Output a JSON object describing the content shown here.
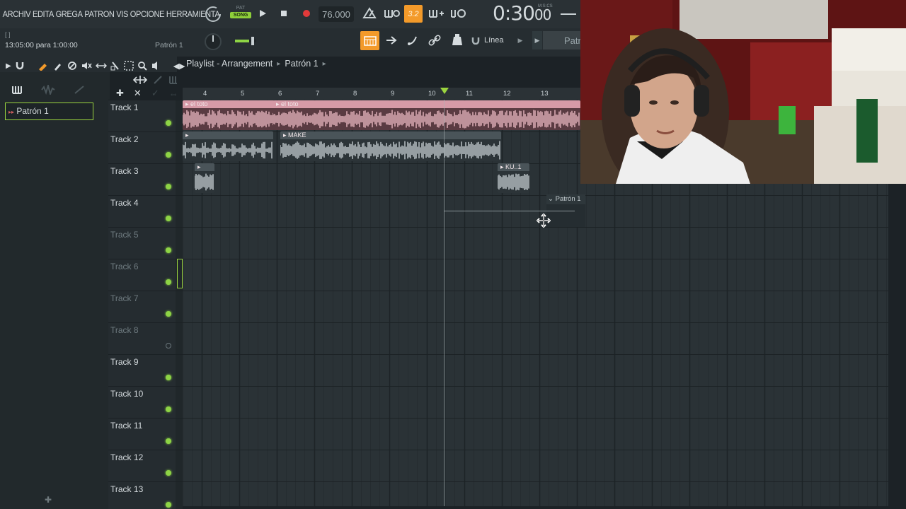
{
  "menu": {
    "items": [
      "ARCHIV",
      "EDITA",
      "GREGA",
      "PATRON",
      "VIS",
      "OPCIONE",
      "HERRAMIENTA"
    ]
  },
  "transport": {
    "pat_label": "PAT",
    "song_label": "SONG",
    "tempo": "76.000",
    "time": "0:30",
    "time_small": "00",
    "time_unit": "M:S:CS",
    "pattern_steps": "3.2"
  },
  "hint": {
    "brackets": "[ ]",
    "text": "13:05:00 para 1:00:00"
  },
  "toolbar": {
    "current_pattern": "Patrón 1",
    "snap_label": "Línea",
    "pattern_tab": "Patr"
  },
  "playlist": {
    "title": "Playlist - Arrangement",
    "pattern_crumb": "Patrón 1",
    "ruler": [
      "4",
      "5",
      "6",
      "7",
      "8",
      "9",
      "10",
      "11",
      "12",
      "13"
    ],
    "tracks": [
      {
        "label": "Track 1",
        "active": true
      },
      {
        "label": "Track 2",
        "active": true
      },
      {
        "label": "Track 3",
        "active": true
      },
      {
        "label": "Track 4",
        "active": true
      },
      {
        "label": "Track 5",
        "active": true
      },
      {
        "label": "Track 6",
        "active": true
      },
      {
        "label": "Track 7",
        "active": true
      },
      {
        "label": "Track 8",
        "active": false
      },
      {
        "label": "Track 9",
        "active": true
      },
      {
        "label": "Track 10",
        "active": true
      },
      {
        "label": "Track 11",
        "active": true
      },
      {
        "label": "Track 12",
        "active": true
      },
      {
        "label": "Track 13",
        "active": true
      }
    ],
    "clips": {
      "c1a": "el toto",
      "c1b": "el toto",
      "c2a": "",
      "c2b": "MAKE",
      "c3a": "",
      "c3b": "KU..1",
      "pattern_clip": "Patrón 1"
    }
  },
  "browser": {
    "items": [
      "Patrón 1"
    ]
  },
  "colors": {
    "accent_green": "#9bd43f",
    "clip_pink": "#e8b7c1",
    "clip_gray": "#c3cbcf",
    "record_red": "#e23a3a",
    "highlight_orange": "#f39a2a"
  }
}
